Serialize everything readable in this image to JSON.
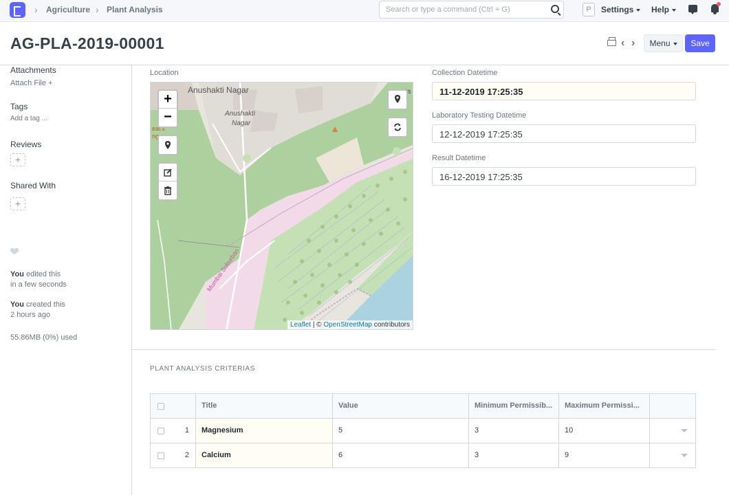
{
  "navbar": {
    "breadcrumbs": [
      "Agriculture",
      "Plant Analysis"
    ],
    "search_placeholder": "Search or type a command (Ctrl + G)",
    "avatar_letter": "P",
    "settings_label": "Settings",
    "help_label": "Help"
  },
  "page": {
    "title": "AG-PLA-2019-00001",
    "menu_label": "Menu",
    "save_label": "Save",
    "accent_color": "#5e64ff"
  },
  "sidebar": {
    "attachments_label": "Attachments",
    "attach_file": "Attach File +",
    "tags_label": "Tags",
    "add_tag": "Add a tag ...",
    "reviews_label": "Reviews",
    "shared_label": "Shared With",
    "edited_user": "You",
    "edited_text": "edited this",
    "edited_time": "in a few seconds",
    "created_user": "You",
    "created_text": "created this",
    "created_time": "2 hours ago",
    "storage": "55.86MB (0%) used"
  },
  "form": {
    "location_label": "Location",
    "collection_label": "Collection Datetime",
    "collection_value": "11-12-2019 17:25:35",
    "lab_label": "Laboratory Testing Datetime",
    "lab_value": "12-12-2019 17:25:35",
    "result_label": "Result Datetime",
    "result_value": "16-12-2019 17:25:35"
  },
  "map": {
    "labels": [
      "Anushakti Nagar",
      "Anushakti",
      "Nagar",
      "Mumbai Suburban",
      "eat's",
      "ng",
      "ta"
    ],
    "attribution_leaflet": "Leaflet",
    "attribution_sep": " | © ",
    "attribution_osm": "OpenStreetMap",
    "attribution_tail": " contributors",
    "zoom_in": "+",
    "zoom_out": "−"
  },
  "table": {
    "section_title": "PLANT ANALYSIS CRITERIAS",
    "columns": [
      "Title",
      "Value",
      "Minimum Permissib...",
      "Maximum Permissi..."
    ],
    "rows": [
      {
        "idx": "1",
        "title": "Magnesium",
        "value": "5",
        "min": "3",
        "max": "10"
      },
      {
        "idx": "2",
        "title": "Calcium",
        "value": "6",
        "min": "3",
        "max": "9"
      }
    ]
  }
}
